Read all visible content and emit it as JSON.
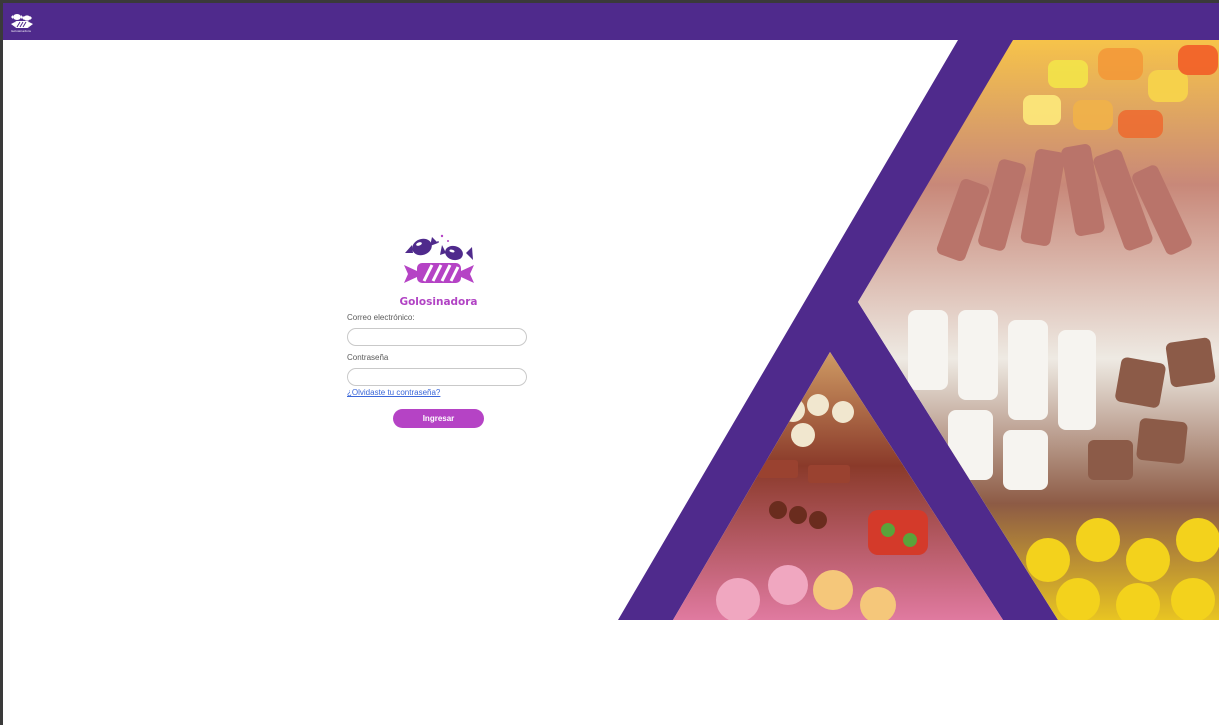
{
  "app": {
    "small_logo_text": "Golosinadora"
  },
  "brand": {
    "name": "Golosinadora"
  },
  "form": {
    "email_label": "Correo electrónico:",
    "email_value": "",
    "password_label": "Contraseña",
    "password_value": "",
    "forgot_link": "¿Olvidaste tu contraseña?",
    "submit_label": "Ingresar"
  },
  "colors": {
    "topbar": "#4f2a8c",
    "accent": "#b543c5",
    "link": "#3a67d9"
  },
  "icons": {
    "small_logo": "candy-logo-icon",
    "brand_logo": "candy-logo-icon",
    "hero": "candy-collage-image"
  }
}
